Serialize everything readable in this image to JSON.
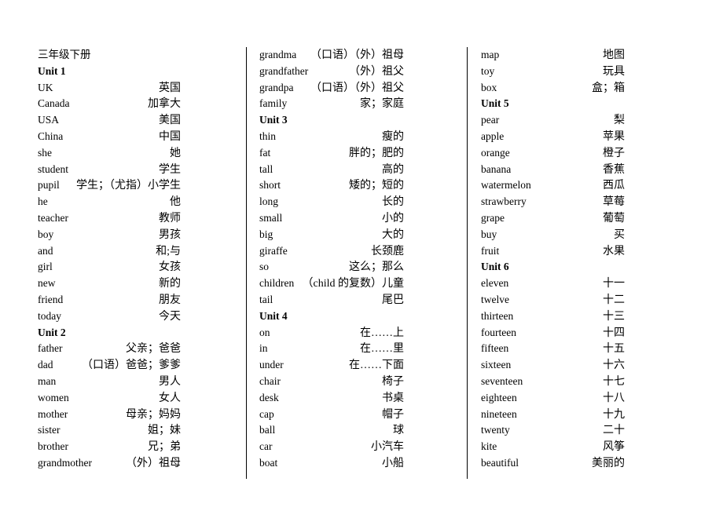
{
  "document": {
    "title": "三年级下册"
  },
  "layout": {
    "column_count": 3,
    "divider_color": "#000000",
    "background_color": "#ffffff",
    "text_color": "#000000"
  },
  "columns": [
    {
      "id": "column-1",
      "rows": [
        {
          "type": "title",
          "term": "三年级下册",
          "gloss": ""
        },
        {
          "type": "heading",
          "term": "Unit 1",
          "gloss": ""
        },
        {
          "type": "entry",
          "term": "UK",
          "gloss": "英国"
        },
        {
          "type": "entry",
          "term": "Canada",
          "gloss": "加拿大"
        },
        {
          "type": "entry",
          "term": "USA",
          "gloss": "美国"
        },
        {
          "type": "entry",
          "term": "China",
          "gloss": "中国"
        },
        {
          "type": "entry",
          "term": "she",
          "gloss": "她"
        },
        {
          "type": "entry",
          "term": "student",
          "gloss": "学生"
        },
        {
          "type": "entry",
          "term": "pupil",
          "gloss": "学生；（尤指）小学生"
        },
        {
          "type": "entry",
          "term": "he",
          "gloss": "他"
        },
        {
          "type": "entry",
          "term": "teacher",
          "gloss": "教师"
        },
        {
          "type": "entry",
          "term": "boy",
          "gloss": "男孩"
        },
        {
          "type": "entry",
          "term": "and",
          "gloss": "和;与"
        },
        {
          "type": "entry",
          "term": "girl",
          "gloss": "女孩"
        },
        {
          "type": "entry",
          "term": "new",
          "gloss": "新的"
        },
        {
          "type": "entry",
          "term": "friend",
          "gloss": "朋友"
        },
        {
          "type": "entry",
          "term": "today",
          "gloss": "今天"
        },
        {
          "type": "heading",
          "term": "Unit 2",
          "gloss": ""
        },
        {
          "type": "entry",
          "term": "father",
          "gloss": "父亲；爸爸"
        },
        {
          "type": "entry",
          "term": "dad",
          "gloss": "（口语）爸爸；爹爹"
        },
        {
          "type": "entry",
          "term": "man",
          "gloss": "男人"
        },
        {
          "type": "entry",
          "term": "women",
          "gloss": "女人"
        },
        {
          "type": "entry",
          "term": "mother",
          "gloss": "母亲；妈妈"
        },
        {
          "type": "entry",
          "term": "sister",
          "gloss": "姐；妹"
        },
        {
          "type": "entry",
          "term": "brother",
          "gloss": "兄；弟"
        },
        {
          "type": "entry",
          "term": "grandmother",
          "gloss": "（外）祖母"
        }
      ]
    },
    {
      "id": "column-2",
      "rows": [
        {
          "type": "entry",
          "term": "grandma",
          "gloss": "（口语）（外）祖母"
        },
        {
          "type": "entry",
          "term": "grandfather",
          "gloss": "（外）祖父"
        },
        {
          "type": "entry",
          "term": "grandpa",
          "gloss": "（口语）（外）祖父"
        },
        {
          "type": "entry",
          "term": "family",
          "gloss": "家；家庭"
        },
        {
          "type": "heading",
          "term": "Unit 3",
          "gloss": ""
        },
        {
          "type": "entry",
          "term": "thin",
          "gloss": "瘦的"
        },
        {
          "type": "entry",
          "term": "fat",
          "gloss": "胖的；肥的"
        },
        {
          "type": "entry",
          "term": "tall",
          "gloss": "高的"
        },
        {
          "type": "entry",
          "term": "short",
          "gloss": "矮的；短的"
        },
        {
          "type": "entry",
          "term": "long",
          "gloss": "长的"
        },
        {
          "type": "entry",
          "term": "small",
          "gloss": "小的"
        },
        {
          "type": "entry",
          "term": "big",
          "gloss": "大的"
        },
        {
          "type": "entry",
          "term": "giraffe",
          "gloss": "长颈鹿"
        },
        {
          "type": "entry",
          "term": "so",
          "gloss": "这么；那么"
        },
        {
          "type": "entry",
          "term": "children",
          "gloss": "（child 的复数）儿童"
        },
        {
          "type": "entry",
          "term": "tail",
          "gloss": "尾巴"
        },
        {
          "type": "heading",
          "term": "Unit 4",
          "gloss": ""
        },
        {
          "type": "entry",
          "term": "on",
          "gloss": "在……上"
        },
        {
          "type": "entry",
          "term": "in",
          "gloss": "在……里"
        },
        {
          "type": "entry",
          "term": "under",
          "gloss": "在……下面"
        },
        {
          "type": "entry",
          "term": "chair",
          "gloss": "椅子"
        },
        {
          "type": "entry",
          "term": "desk",
          "gloss": "书桌"
        },
        {
          "type": "entry",
          "term": "cap",
          "gloss": "帽子"
        },
        {
          "type": "entry",
          "term": "ball",
          "gloss": "球"
        },
        {
          "type": "entry",
          "term": "car",
          "gloss": "小汽车"
        },
        {
          "type": "entry",
          "term": "boat",
          "gloss": "小船"
        }
      ]
    },
    {
      "id": "column-3",
      "rows": [
        {
          "type": "entry",
          "term": "map",
          "gloss": "地图"
        },
        {
          "type": "entry",
          "term": "toy",
          "gloss": "玩具"
        },
        {
          "type": "entry",
          "term": "box",
          "gloss": "盒；箱"
        },
        {
          "type": "heading",
          "term": "Unit 5",
          "gloss": ""
        },
        {
          "type": "entry",
          "term": "pear",
          "gloss": "梨"
        },
        {
          "type": "entry",
          "term": "apple",
          "gloss": "苹果"
        },
        {
          "type": "entry",
          "term": "orange",
          "gloss": "橙子"
        },
        {
          "type": "entry",
          "term": "banana",
          "gloss": "香蕉"
        },
        {
          "type": "entry",
          "term": "watermelon",
          "gloss": "西瓜"
        },
        {
          "type": "entry",
          "term": "strawberry",
          "gloss": "草莓"
        },
        {
          "type": "entry",
          "term": "grape",
          "gloss": "葡萄"
        },
        {
          "type": "entry",
          "term": "buy",
          "gloss": "买"
        },
        {
          "type": "entry",
          "term": "fruit",
          "gloss": "水果"
        },
        {
          "type": "heading",
          "term": "Unit 6",
          "gloss": ""
        },
        {
          "type": "entry",
          "term": "eleven",
          "gloss": "十一"
        },
        {
          "type": "entry",
          "term": "twelve",
          "gloss": "十二"
        },
        {
          "type": "entry",
          "term": "thirteen",
          "gloss": "十三"
        },
        {
          "type": "entry",
          "term": "fourteen",
          "gloss": "十四"
        },
        {
          "type": "entry",
          "term": "fifteen",
          "gloss": "十五"
        },
        {
          "type": "entry",
          "term": "sixteen",
          "gloss": "十六"
        },
        {
          "type": "entry",
          "term": "seventeen",
          "gloss": "十七"
        },
        {
          "type": "entry",
          "term": "eighteen",
          "gloss": "十八"
        },
        {
          "type": "entry",
          "term": "nineteen",
          "gloss": "十九"
        },
        {
          "type": "entry",
          "term": "twenty",
          "gloss": "二十"
        },
        {
          "type": "entry",
          "term": "kite",
          "gloss": "风筝"
        },
        {
          "type": "entry",
          "term": "beautiful",
          "gloss": "美丽的"
        }
      ]
    }
  ]
}
